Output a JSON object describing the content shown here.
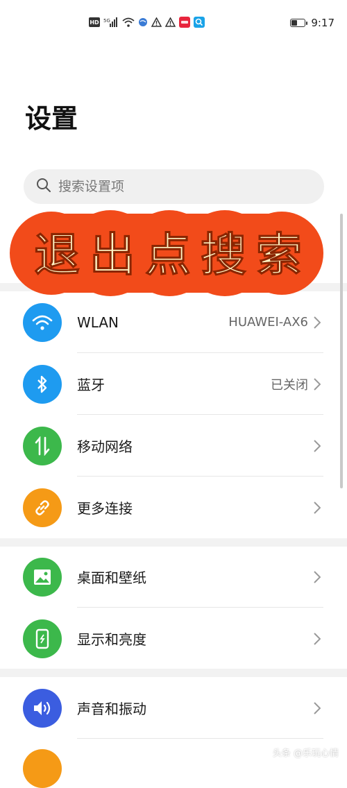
{
  "status_bar": {
    "time": "9:17",
    "hd_label": "HD",
    "network_label": "5G",
    "icons": [
      "hd-icon",
      "signal-icon",
      "wifi-icon",
      "globe-icon",
      "warning-icon",
      "warning-icon",
      "app-icon",
      "search-app-icon",
      "battery-icon"
    ]
  },
  "page": {
    "title": "设置"
  },
  "search": {
    "placeholder": "搜索设置项"
  },
  "banner": {
    "text": [
      "退",
      "出",
      "点",
      "搜",
      "索"
    ],
    "color": "#f24b1a",
    "text_color": "#fff3c4"
  },
  "list": {
    "items": [
      {
        "label": "WLAN",
        "value": "HUAWEI-AX6",
        "icon": "wifi-icon",
        "color": "#1e9bf0"
      },
      {
        "label": "蓝牙",
        "value": "已关闭",
        "icon": "bluetooth-icon",
        "color": "#1e9bf0"
      },
      {
        "label": "移动网络",
        "value": "",
        "icon": "mobile-data-icon",
        "color": "#3cb84b"
      },
      {
        "label": "更多连接",
        "value": "",
        "icon": "link-icon",
        "color": "#f59a16"
      },
      {
        "label": "桌面和壁纸",
        "value": "",
        "icon": "wallpaper-icon",
        "color": "#3cb84b"
      },
      {
        "label": "显示和亮度",
        "value": "",
        "icon": "display-icon",
        "color": "#3cb84b"
      },
      {
        "label": "声音和振动",
        "value": "",
        "icon": "sound-icon",
        "color": "#3b5de0"
      }
    ]
  },
  "watermark": "头条 @乐玩心情"
}
